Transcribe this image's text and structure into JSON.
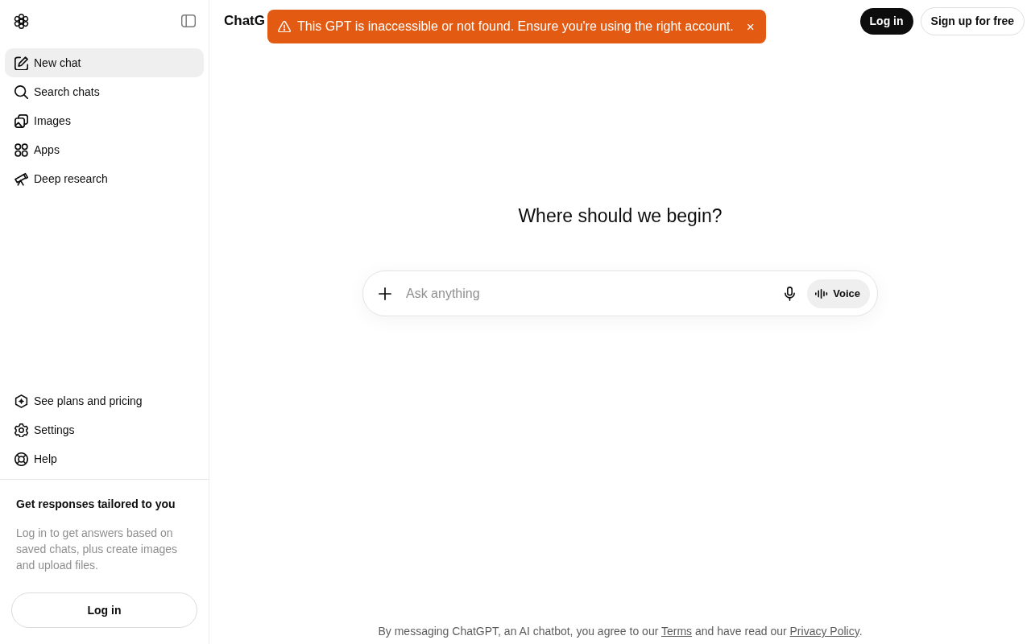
{
  "sidebar": {
    "nav_items": [
      {
        "label": "New chat",
        "selected": true
      },
      {
        "label": "Search chats",
        "selected": false
      },
      {
        "label": "Images",
        "selected": false
      },
      {
        "label": "Apps",
        "selected": false
      },
      {
        "label": "Deep research",
        "selected": false
      }
    ],
    "bottom_items": [
      {
        "label": "See plans and pricing",
        "selected": false
      },
      {
        "label": "Settings",
        "selected": false
      },
      {
        "label": "Help",
        "selected": false
      }
    ],
    "promo": {
      "title": "Get responses tailored to you",
      "body": "Log in to get answers based on saved chats, plus create images and upload files.",
      "button": "Log in"
    }
  },
  "header": {
    "title": "ChatG",
    "login_button": "Log in",
    "signup_button": "Sign up for free"
  },
  "toast": {
    "message": "This GPT is inaccessible or not found. Ensure you're using the right account.",
    "close": "×"
  },
  "main": {
    "heading": "Where should we begin?",
    "composer": {
      "placeholder": "Ask anything",
      "voice_button": "Voice"
    }
  },
  "footer": {
    "text_before": "By messaging ChatGPT, an AI chatbot, you agree to our",
    "terms_link": "Terms",
    "text_middle": "and have read our",
    "privacy_link": "Privacy Policy",
    "text_after": "."
  }
}
